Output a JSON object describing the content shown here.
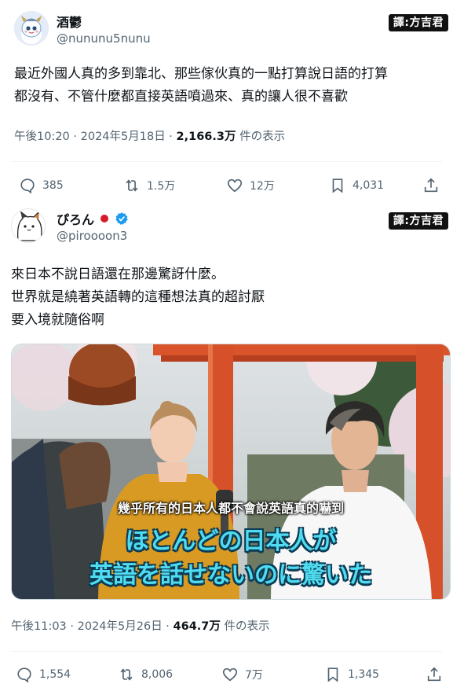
{
  "post1": {
    "display_name": "酒鬱",
    "handle": "@nununu5nunu",
    "watermark": "譯:方吉君",
    "text_lines": [
      "最近外國人真的多到靠北、那些傢伙真的一點打算說日語的打算",
      "都沒有、不管什麼都直接英語噴過來、真的讓人很不喜歡"
    ],
    "time": "午後10:20 · 2024年5月18日 · ",
    "views_count": "2,166.3万",
    "views_label": " 件の表示",
    "actions": {
      "replies": "385",
      "reposts": "1.5万",
      "likes": "12万",
      "bookmarks": "4,031"
    }
  },
  "post2": {
    "display_name": "ぴろん",
    "flag_icon": "japan-flag-icon",
    "handle": "@piroooon3",
    "watermark": "譯:方吉君",
    "text_lines": [
      "來日本不說日語還在那邊驚訝什麼。",
      "世界就是繞著英語轉的這種想法真的超討厭",
      "要入境就隨俗啊"
    ],
    "video": {
      "subtitle_zh": "幾乎所有的日本人都不會說英語真的嚇到",
      "subtitle_jp_1": "ほとんどの日本人が",
      "subtitle_jp_2": "英語を話せないのに驚いた"
    },
    "time": "午後11:03 · 2024年5月26日 · ",
    "views_count": "464.7万",
    "views_label": " 件の表示",
    "actions": {
      "replies": "1,554",
      "reposts": "8,006",
      "likes": "7万",
      "bookmarks": "1,345"
    }
  },
  "colors": {
    "text": "#0f1419",
    "secondary": "#536471",
    "verified": "#1d9bf0",
    "divider": "#eff3f4"
  }
}
